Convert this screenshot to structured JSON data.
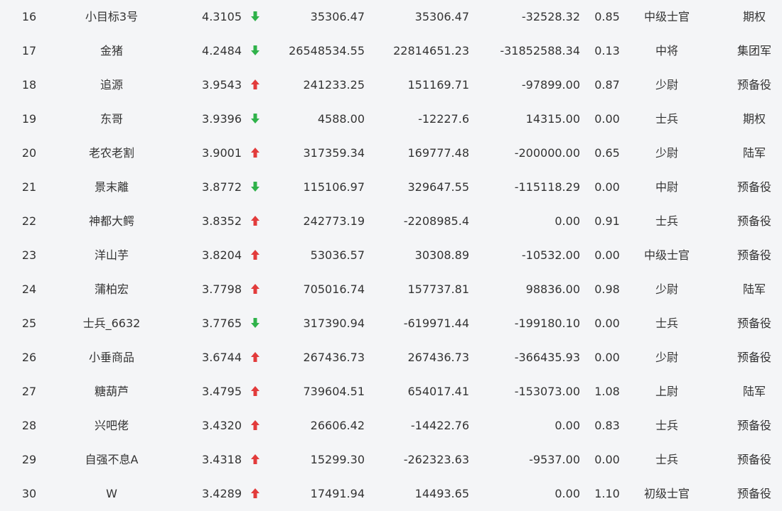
{
  "colors": {
    "up": "#e23b3b",
    "down": "#2fb24a",
    "text": "#333333",
    "background": "#f4f5f7"
  },
  "rows": [
    {
      "rank": "16",
      "name": "小目标3号",
      "score": "4.3105",
      "trend": "down",
      "trend_icon": "arrow-down-icon",
      "v1": "35306.47",
      "v2": "35306.47",
      "v3": "-32528.32",
      "ratio": "0.85",
      "level": "中级士官",
      "category": "期权"
    },
    {
      "rank": "17",
      "name": "金猪",
      "score": "4.2484",
      "trend": "down",
      "trend_icon": "arrow-down-icon",
      "v1": "26548534.55",
      "v2": "22814651.23",
      "v3": "-31852588.34",
      "ratio": "0.13",
      "level": "中将",
      "category": "集团军"
    },
    {
      "rank": "18",
      "name": "追源",
      "score": "3.9543",
      "trend": "up",
      "trend_icon": "arrow-up-icon",
      "v1": "241233.25",
      "v2": "151169.71",
      "v3": "-97899.00",
      "ratio": "0.87",
      "level": "少尉",
      "category": "预备役"
    },
    {
      "rank": "19",
      "name": "东哥",
      "score": "3.9396",
      "trend": "down",
      "trend_icon": "arrow-down-icon",
      "v1": "4588.00",
      "v2": "-12227.6",
      "v3": "14315.00",
      "ratio": "0.00",
      "level": "士兵",
      "category": "期权"
    },
    {
      "rank": "20",
      "name": "老农老割",
      "score": "3.9001",
      "trend": "up",
      "trend_icon": "arrow-up-icon",
      "v1": "317359.34",
      "v2": "169777.48",
      "v3": "-200000.00",
      "ratio": "0.65",
      "level": "少尉",
      "category": "陆军"
    },
    {
      "rank": "21",
      "name": "景末離",
      "score": "3.8772",
      "trend": "down",
      "trend_icon": "arrow-down-icon",
      "v1": "115106.97",
      "v2": "329647.55",
      "v3": "-115118.29",
      "ratio": "0.00",
      "level": "中尉",
      "category": "预备役"
    },
    {
      "rank": "22",
      "name": "神都大鳄",
      "score": "3.8352",
      "trend": "up",
      "trend_icon": "arrow-up-icon",
      "v1": "242773.19",
      "v2": "-2208985.4",
      "v3": "0.00",
      "ratio": "0.91",
      "level": "士兵",
      "category": "预备役"
    },
    {
      "rank": "23",
      "name": "洋山芋",
      "score": "3.8204",
      "trend": "up",
      "trend_icon": "arrow-up-icon",
      "v1": "53036.57",
      "v2": "30308.89",
      "v3": "-10532.00",
      "ratio": "0.00",
      "level": "中级士官",
      "category": "预备役"
    },
    {
      "rank": "24",
      "name": "蒲柏宏",
      "score": "3.7798",
      "trend": "up",
      "trend_icon": "arrow-up-icon",
      "v1": "705016.74",
      "v2": "157737.81",
      "v3": "98836.00",
      "ratio": "0.98",
      "level": "少尉",
      "category": "陆军"
    },
    {
      "rank": "25",
      "name": "士兵_6632",
      "score": "3.7765",
      "trend": "down",
      "trend_icon": "arrow-down-icon",
      "v1": "317390.94",
      "v2": "-619971.44",
      "v3": "-199180.10",
      "ratio": "0.00",
      "level": "士兵",
      "category": "预备役"
    },
    {
      "rank": "26",
      "name": "小垂商品",
      "score": "3.6744",
      "trend": "up",
      "trend_icon": "arrow-up-icon",
      "v1": "267436.73",
      "v2": "267436.73",
      "v3": "-366435.93",
      "ratio": "0.00",
      "level": "少尉",
      "category": "预备役"
    },
    {
      "rank": "27",
      "name": "糖葫芦",
      "score": "3.4795",
      "trend": "up",
      "trend_icon": "arrow-up-icon",
      "v1": "739604.51",
      "v2": "654017.41",
      "v3": "-153073.00",
      "ratio": "1.08",
      "level": "上尉",
      "category": "陆军"
    },
    {
      "rank": "28",
      "name": "兴吧佬",
      "score": "3.4320",
      "trend": "up",
      "trend_icon": "arrow-up-icon",
      "v1": "26606.42",
      "v2": "-14422.76",
      "v3": "0.00",
      "ratio": "0.83",
      "level": "士兵",
      "category": "预备役"
    },
    {
      "rank": "29",
      "name": "自强不息A",
      "score": "3.4318",
      "trend": "up",
      "trend_icon": "arrow-up-icon",
      "v1": "15299.30",
      "v2": "-262323.63",
      "v3": "-9537.00",
      "ratio": "0.00",
      "level": "士兵",
      "category": "预备役"
    },
    {
      "rank": "30",
      "name": "W",
      "score": "3.4289",
      "trend": "up",
      "trend_icon": "arrow-up-icon",
      "v1": "17491.94",
      "v2": "14493.65",
      "v3": "0.00",
      "ratio": "1.10",
      "level": "初级士官",
      "category": "预备役"
    }
  ]
}
